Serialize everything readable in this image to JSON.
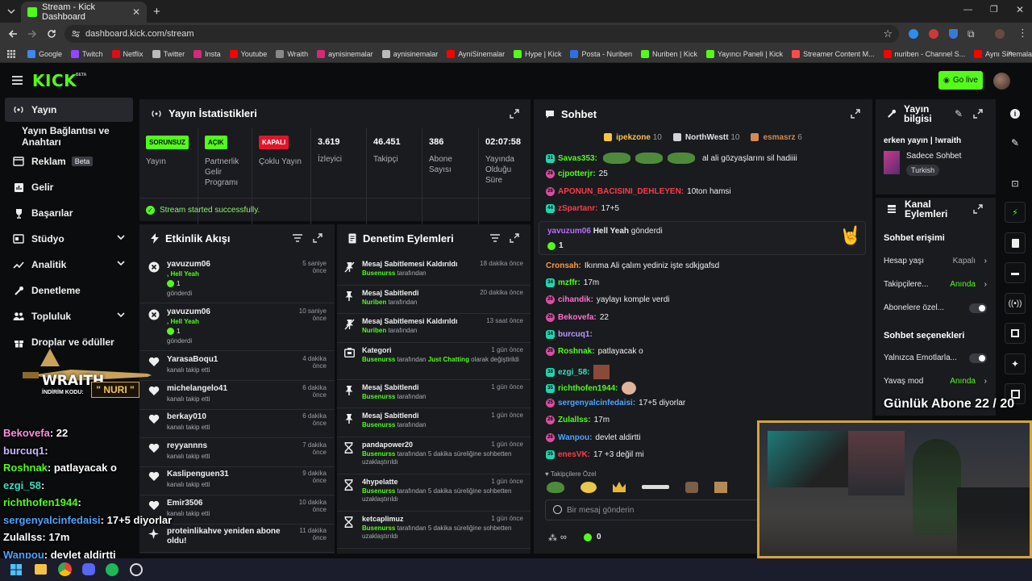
{
  "browser": {
    "tab_title": "Stream - Kick Dashboard",
    "url": "dashboard.kick.com/stream",
    "bookmarks": [
      {
        "label": "Google",
        "color": "#4285f4"
      },
      {
        "label": "Twitch",
        "color": "#9146ff"
      },
      {
        "label": "Netflix",
        "color": "#e50914"
      },
      {
        "label": "Twitter",
        "color": "#bbbbbb"
      },
      {
        "label": "Insta",
        "color": "#d62976"
      },
      {
        "label": "Youtube",
        "color": "#ff0000"
      },
      {
        "label": "Wraith",
        "color": "#888888"
      },
      {
        "label": "aynisinemalar",
        "color": "#d62976"
      },
      {
        "label": "aynisinemalar",
        "color": "#bbbbbb"
      },
      {
        "label": "AyniSinemalar",
        "color": "#ff0000"
      },
      {
        "label": "Hype | Kick",
        "color": "#53fc18"
      },
      {
        "label": "Posta - Nuriben",
        "color": "#2f6fde"
      },
      {
        "label": "Nuriben | Kick",
        "color": "#53fc18"
      },
      {
        "label": "Yayıncı Paneli | Kick",
        "color": "#53fc18"
      },
      {
        "label": "Streamer Content M...",
        "color": "#ff4a4a"
      },
      {
        "label": "nuriben - Channel S...",
        "color": "#ff0000"
      },
      {
        "label": "Aynı Sinemalar - Ça...",
        "color": "#ff0000"
      }
    ]
  },
  "header": {
    "logo": "KICK",
    "beta": "BETA",
    "go_live": "Go live"
  },
  "sidebar": {
    "items": [
      {
        "label": "Yayın",
        "icon": "broadcast-icon"
      },
      {
        "label": "Yayın Bağlantısı ve Anahtarı",
        "icon": ""
      },
      {
        "label": "Reklam",
        "icon": "ad-icon",
        "badge": "Beta"
      },
      {
        "label": "Gelir",
        "icon": "chart-icon"
      },
      {
        "label": "Başarılar",
        "icon": "trophy-icon"
      },
      {
        "label": "Stüdyo",
        "icon": "studio-icon"
      },
      {
        "label": "Analitik",
        "icon": "analytics-icon"
      },
      {
        "label": "Denetleme",
        "icon": "wrench-icon"
      },
      {
        "label": "Topluluk",
        "icon": "community-icon"
      },
      {
        "label": "Droplar ve ödüller",
        "icon": "gift-icon"
      }
    ]
  },
  "stats": {
    "title": "Yayın İstatistikleri",
    "boxes": [
      {
        "badge": "SORUNSUZ",
        "badge_color": "#53fc18",
        "label": "Yayın"
      },
      {
        "badge": "AÇIK",
        "badge_color": "#53fc18",
        "label": "Partnerlik Gelir Programı"
      },
      {
        "badge": "KAPALI",
        "badge_color": "#e0152a",
        "label": "Çoklu Yayın"
      },
      {
        "value": "3.619",
        "label": "İzleyici"
      },
      {
        "value": "46.451",
        "label": "Takipçi"
      },
      {
        "value": "386",
        "label": "Abone Sayısı"
      },
      {
        "value": "02:07:58",
        "label": "Yayında Olduğu Süre"
      }
    ],
    "success": "Stream started successfully."
  },
  "activity": {
    "title": "Etkinlik Akışı",
    "items": [
      {
        "name": "yavuzum06",
        "time": "5 saniye önce",
        "extra": ", Hell Yeah",
        "count": "1",
        "sub": "gönderdi",
        "icon": "close-circle-icon"
      },
      {
        "name": "yavuzum06",
        "time": "10 saniye önce",
        "extra": ", Hell Yeah",
        "count": "1",
        "sub": "gönderdi",
        "icon": "close-circle-icon"
      },
      {
        "name": "YarasaBoqu1",
        "time": "4 dakika önce",
        "sub": "kanalı takip etti",
        "icon": "heart-icon"
      },
      {
        "name": "michelangelo41",
        "time": "6 dakika önce",
        "sub": "kanalı takip etti",
        "icon": "heart-icon"
      },
      {
        "name": "berkay010",
        "time": "6 dakika önce",
        "sub": "kanalı takip etti",
        "icon": "heart-icon"
      },
      {
        "name": "reyyannns",
        "time": "7 dakika önce",
        "sub": "kanalı takip etti",
        "icon": "heart-icon"
      },
      {
        "name": "Kaslipenguen31",
        "time": "9 dakika önce",
        "sub": "kanalı takip etti",
        "icon": "heart-icon"
      },
      {
        "name": "Emir3506",
        "time": "10 dakika önce",
        "sub": "kanalı takip etti",
        "icon": "heart-icon"
      },
      {
        "name": "proteinlikahve yeniden abone oldu!",
        "time": "11 dakika önce",
        "sub": "",
        "icon": "sparkle-icon"
      }
    ]
  },
  "moderation": {
    "title": "Denetim Eylemleri",
    "items": [
      {
        "action": "Mesaj Sabitlemesi Kaldırıldı",
        "time": "18 dakika önce",
        "who": "Busenurss",
        "rest": " tarafından",
        "icon": "unpin-icon"
      },
      {
        "action": "Mesaj Sabitlendi",
        "time": "20 dakika önce",
        "who": "Nuriben",
        "rest": " tarafından",
        "icon": "pin-icon"
      },
      {
        "action": "Mesaj Sabitlemesi Kaldırıldı",
        "time": "13 saat önce",
        "who": "Nuriben",
        "rest": " tarafından",
        "icon": "unpin-icon"
      },
      {
        "action": "Kategori",
        "time": "1 gün önce",
        "who": "Busenurss",
        "rest": " tarafından ",
        "hl": "Just Chatting",
        "rest2": " olarak değiştirildi",
        "icon": "category-icon"
      },
      {
        "action": "Mesaj Sabitlendi",
        "time": "1 gün önce",
        "who": "Busenurss",
        "rest": " tarafından",
        "icon": "pin-icon"
      },
      {
        "action": "Mesaj Sabitlendi",
        "time": "1 gün önce",
        "who": "Busenurss",
        "rest": " tarafından",
        "icon": "pin-icon"
      },
      {
        "action": "pandapower20",
        "time": "1 gün önce",
        "who": "Busenurss",
        "rest": " tarafından 5 dakika süreliğine sohbetten uzaklaştırıldı",
        "icon": "hourglass-icon"
      },
      {
        "action": "4hypelatte",
        "time": "1 gün önce",
        "who": "Busenurss",
        "rest": " tarafından 5 dakika süreliğine sohbetten uzaklaştırıldı",
        "icon": "hourglass-icon"
      },
      {
        "action": "ketcaplimuz",
        "time": "1 gün önce",
        "who": "Busenurss",
        "rest": " tarafından 5 dakika süreliğine sohbetten uzaklaştırıldı",
        "icon": "hourglass-icon"
      }
    ]
  },
  "chat": {
    "title": "Sohbet",
    "leaders": [
      {
        "name": "ipekzone",
        "count": "10",
        "color": "#f5c542"
      },
      {
        "name": "NorthWestt",
        "count": "10",
        "color": "#cfd3da"
      },
      {
        "name": "esmasrz",
        "count": "6",
        "color": "#d38b56"
      }
    ],
    "messages": [
      {
        "badge": "31",
        "badge_type": "t",
        "user": "Savas353:",
        "color": "#53fc18",
        "text": "al ali gözyaşlarını sil hadiiii"
      },
      {
        "badge": "26",
        "badge_type": "p",
        "user": "cjpotterjr:",
        "color": "#53fc18",
        "text": "25"
      },
      {
        "badge": "26",
        "badge_type": "p",
        "user": "APONUN_BACISINI_DEHLEYEN:",
        "color": "#ff3b4a",
        "text": "10ton hamsi"
      },
      {
        "badge": "44",
        "badge_type": "t",
        "user": "zSpartanr:",
        "color": "#ff3b4a",
        "text": "17+5"
      },
      {
        "badge": "",
        "badge_type": "",
        "user": "Cronsah:",
        "color": "#ff9a3c",
        "text": "Ikınma Ali çalım yediniz işte sdkjgafsd"
      },
      {
        "badge": "34",
        "badge_type": "t",
        "user": "mzffr:",
        "color": "#53fc18",
        "text": "17m"
      },
      {
        "badge": "26",
        "badge_type": "p",
        "user": "cihandik:",
        "color": "#ff6fcf",
        "text": "yaylayı komple verdi"
      },
      {
        "badge": "26",
        "badge_type": "p",
        "user": "Bekovefa:",
        "color": "#ff6fcf",
        "text": "22"
      },
      {
        "badge": "34",
        "badge_type": "t",
        "user": "burcuq1:",
        "color": "#b69cff",
        "text": ""
      },
      {
        "badge": "26",
        "badge_type": "p",
        "user": "Roshnak:",
        "color": "#53fc18",
        "text": "patlayacak o"
      },
      {
        "badge": "38",
        "badge_type": "t",
        "user": "ezgi_58:",
        "color": "#3adfc4",
        "text": ""
      },
      {
        "badge": "35",
        "badge_type": "t",
        "user": "richthofen1944:",
        "color": "#53fc18",
        "text": ""
      },
      {
        "badge": "25",
        "badge_type": "p",
        "user": "sergenyalcinfedaisi:",
        "color": "#4fa3ff",
        "text": "17+5 diyorlar"
      },
      {
        "badge": "26",
        "badge_type": "p",
        "user": "Zulallss:",
        "color": "#53fc18",
        "text": "17m"
      },
      {
        "badge": "26",
        "badge_type": "p",
        "user": "Wanpou:",
        "color": "#4fa3ff",
        "text": "devlet aldirtti"
      },
      {
        "badge": "35",
        "badge_type": "t",
        "user": "enesVK:",
        "color": "#ff3b4a",
        "text": "17 +3 değil mi"
      }
    ],
    "gift": {
      "user": "yavuzum06",
      "text": "Hell Yeah",
      "suffix": "gönderdi",
      "count": "1"
    },
    "emote_label": "Takipçilere Özel",
    "placeholder": "Bir mesaj gönderin",
    "kicks": "0"
  },
  "stream_info": {
    "title": "Yayın bilgisi",
    "stream_title": "erken yayın | !wraith",
    "category": "Sadece Sohbet",
    "language": "Turkish"
  },
  "channel_actions": {
    "title": "Kanal Eylemleri",
    "chat_access": "Sohbet erişimi",
    "account_age": "Hesap yaşı",
    "account_age_val": "Kapalı",
    "followers": "Takipçilere...",
    "followers_val": "Anında",
    "subs": "Abonelere özel...",
    "chat_options": "Sohbet seçenekleri",
    "emotes_only": "Yalnızca Emotlarla...",
    "slow": "Yavaş mod",
    "slow_val": "Anında"
  },
  "overlay": {
    "brand": "WRAITH.",
    "code_label": "İNDİRİM KODU:",
    "code": "\" NURI \"",
    "sub_goal": "Günlük Abone 22 / 20",
    "lines": [
      {
        "user": "Bekovefa",
        "text": ": 22",
        "color": "#ff8fd8"
      },
      {
        "user": "burcuq1",
        "text": ":",
        "color": "#c9b6ff"
      },
      {
        "user": "Roshnak",
        "text": ": patlayacak o",
        "color": "#53fc18"
      },
      {
        "user": "ezgi_58",
        "text": ":",
        "color": "#3adfc4"
      },
      {
        "user": "richthofen1944",
        "text": ":",
        "color": "#53fc18"
      },
      {
        "user": "sergenyalcinfedaisi",
        "text": ": 17+5 diyorlar",
        "color": "#4fa3ff"
      },
      {
        "user": "Zulallss",
        "text": ": 17m",
        "color": "#ffffff"
      },
      {
        "user": "Wanpou",
        "text": ": devlet aldirtti",
        "color": "#4fa3ff"
      }
    ]
  }
}
